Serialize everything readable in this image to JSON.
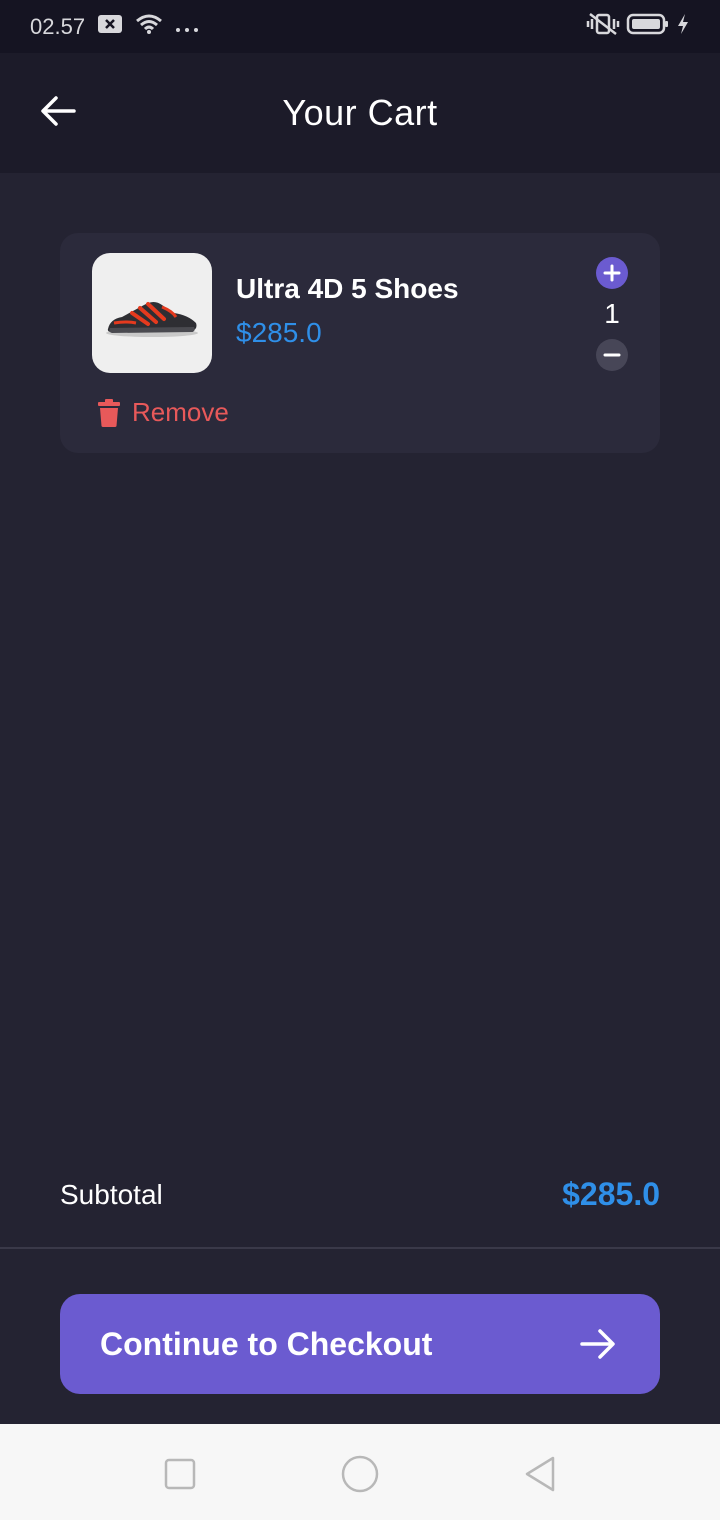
{
  "status_bar": {
    "time": "02.57",
    "icons": [
      "notification-x-icon",
      "wifi-icon",
      "more-dots-icon",
      "vibrate-off-icon",
      "battery-icon",
      "charging-icon"
    ]
  },
  "header": {
    "title": "Your Cart",
    "back_icon": "arrow-left-icon"
  },
  "cart": {
    "items": [
      {
        "name": "Ultra 4D 5 Shoes",
        "price": "$285.0",
        "quantity": "1",
        "image": "shoe-image",
        "remove_label": "Remove"
      }
    ]
  },
  "summary": {
    "subtotal_label": "Subtotal",
    "subtotal_value": "$285.0"
  },
  "checkout": {
    "label": "Continue to Checkout",
    "icon": "arrow-right-icon"
  },
  "colors": {
    "background": "#242332",
    "card": "#2b2a3b",
    "accent": "#6b5bd0",
    "price": "#2f8fe8",
    "danger": "#e8595a"
  },
  "nav_bar": {
    "buttons": [
      "recents-square-icon",
      "home-circle-icon",
      "back-triangle-icon"
    ]
  }
}
